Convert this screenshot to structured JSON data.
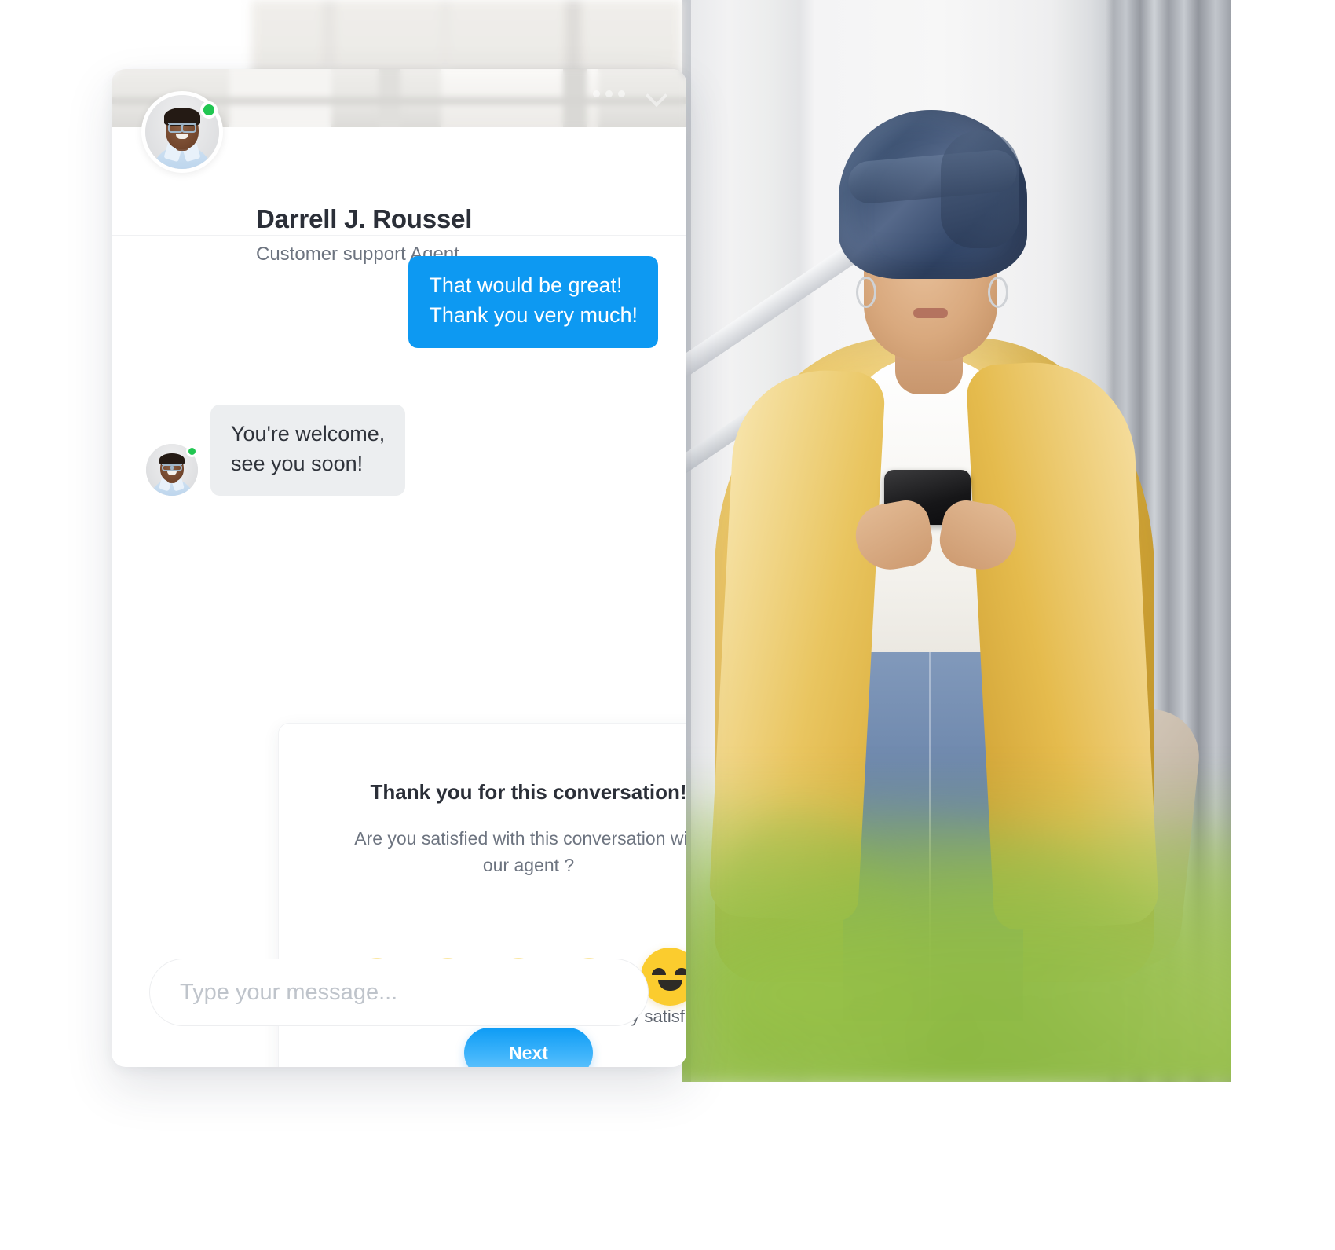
{
  "window": {
    "controls": {
      "more_icon": "more-dots-icon",
      "collapse_icon": "chevron-down-icon"
    }
  },
  "header": {
    "agent_name": "Darrell J. Roussel",
    "agent_role": "Customer support Agent",
    "status": "online",
    "status_color": "#20c651",
    "avatar_icon": "agent-avatar"
  },
  "messages": [
    {
      "direction": "outgoing",
      "text": "That would be great!\nThank you very much!",
      "line1": "That would be great!",
      "line2": "Thank you very much!",
      "bubble_color": "#0d99f2"
    },
    {
      "direction": "incoming",
      "text": "You're welcome,\nsee you soon!",
      "line1": "You're welcome,",
      "line2": "see you soon!",
      "bubble_color": "#eceef0"
    }
  ],
  "survey": {
    "title": "Thank you for this conversation!",
    "question": "Are you satisfied with this conversation with our agent ?",
    "ratings": [
      {
        "id": 1,
        "icon": "face-very-dissatisfied-icon",
        "label": "",
        "selected": false
      },
      {
        "id": 2,
        "icon": "face-dissatisfied-icon",
        "label": "",
        "selected": false
      },
      {
        "id": 3,
        "icon": "face-neutral-icon",
        "label": "",
        "selected": false
      },
      {
        "id": 4,
        "icon": "face-satisfied-icon",
        "label": "",
        "selected": false
      },
      {
        "id": 5,
        "icon": "face-very-satisfied-icon",
        "label": "very satisfied",
        "selected": true
      }
    ],
    "selected_label": "very satisfied",
    "next_label": "Next",
    "accent_color": "#0e9cf5"
  },
  "composer": {
    "placeholder": "Type your message...",
    "value": ""
  },
  "photo": {
    "description": "woman-with-navy-headwrap-using-phone"
  }
}
